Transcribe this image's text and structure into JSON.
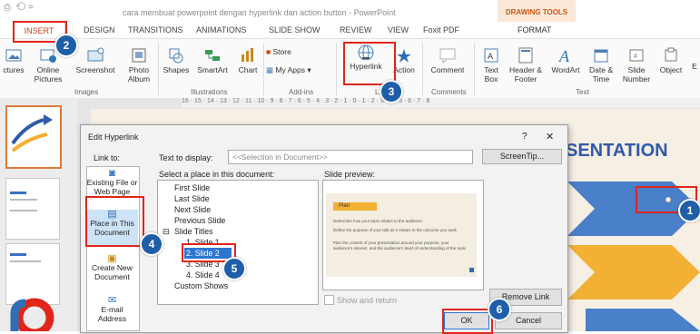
{
  "window": {
    "title": "cara membuat powerpoint dengan hyperlink dan action button - PowerPoint",
    "contextual_group": "DRAWING TOOLS"
  },
  "tabs": [
    "INSERT",
    "DESIGN",
    "TRANSITIONS",
    "ANIMATIONS",
    "SLIDE SHOW",
    "REVIEW",
    "VIEW",
    "Foxit PDF",
    "FORMAT"
  ],
  "ribbon": {
    "buttons": [
      "ctures",
      "Online Pictures",
      "Screenshot",
      "Photo Album",
      "Shapes",
      "SmartArt",
      "Chart",
      "Store",
      "My Apps",
      "Hyperlink",
      "Action",
      "Comment",
      "Text Box",
      "Header & Footer",
      "WordArt",
      "Date & Time",
      "Slide Number",
      "Object",
      "E"
    ],
    "groups": [
      "Images",
      "Illustrations",
      "Add-ins",
      "Links",
      "Comments",
      "Text"
    ]
  },
  "ruler": "16 · 15 · 14 · 13 · 12 · 11 · 10 · 9 · 8 · 7 · 6 · 5 · 4 · 3 · 2 · 1 · 0 · 1 · 2 · 3 · 4 · 5 · 6 · 7 · 8",
  "slide": {
    "title_fragment": "SENTATION"
  },
  "dialog": {
    "title": "Edit Hyperlink",
    "help": "?",
    "close": "✕",
    "link_to_label": "Link to:",
    "text_to_display_label": "Text to display:",
    "text_to_display_value": "<<Selection in Document>>",
    "screentip_button": "ScreenTip...",
    "place_label": "Select a place in this document:",
    "preview_label": "Slide preview:",
    "link_to_items": [
      "Existing File or Web Page",
      "Place in This Document",
      "Create New Document",
      "E-mail Address"
    ],
    "tree": [
      "First Slide",
      "Last Slide",
      "Next Slide",
      "Previous Slide",
      "Slide Titles",
      "1. Slide 1",
      "2. Slide 2",
      "3. Slide 3",
      "4. Slide 4",
      "Custom Shows"
    ],
    "show_and_return": "Show and return",
    "remove_link_button": "Remove Link",
    "ok_button": "OK",
    "cancel_button": "Cancel",
    "preview_text": {
      "heading": "Plan",
      "lines": [
        "Determine how your topic relates to the audience.",
        "Define the purpose of your talk as it relates to the outcome you seek.",
        "Plan the content of your presentation around your purpose, your audience's interest, and the audience's level of understanding of the topic."
      ]
    }
  },
  "annotations": [
    "1",
    "2",
    "3",
    "4",
    "5",
    "6"
  ],
  "colors": {
    "accent_red": "#e0261b",
    "badge_blue": "#1f5ea8",
    "tab_red": "#c43e1c",
    "drawing_tools_orange": "#c55a11"
  }
}
